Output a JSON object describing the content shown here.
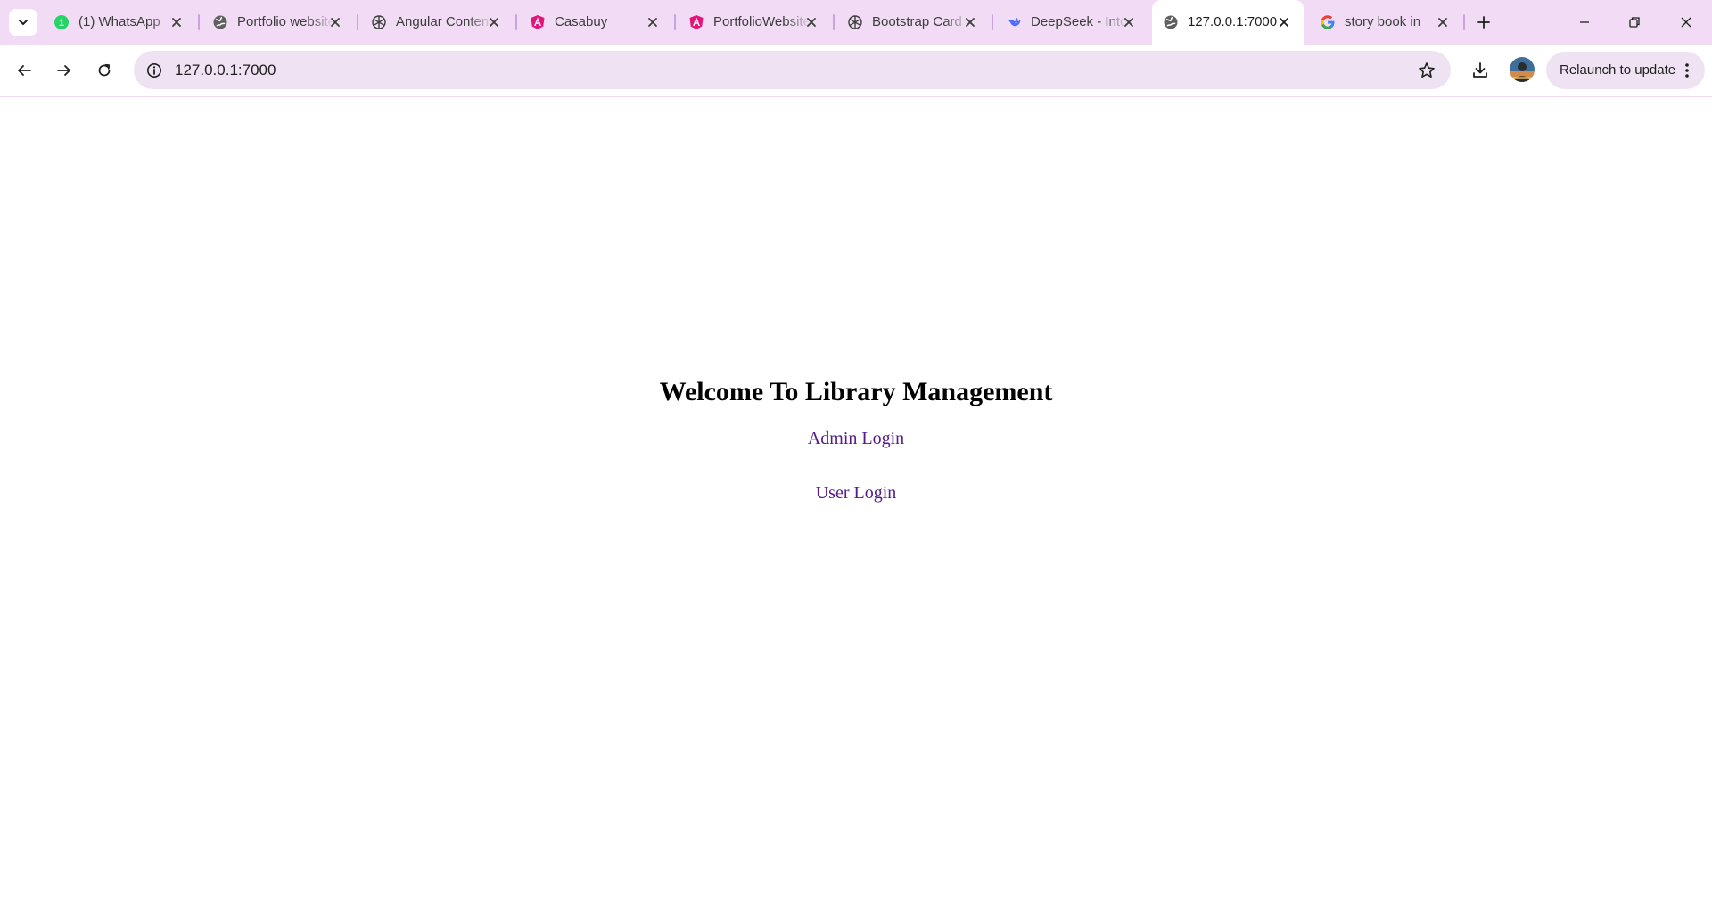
{
  "browser": {
    "tabs": [
      {
        "title": "(1) WhatsApp",
        "favicon": "whatsapp-icon",
        "active": false
      },
      {
        "title": "Portfolio website",
        "favicon": "globe-icon",
        "active": false
      },
      {
        "title": "Angular Content",
        "favicon": "chatgpt-icon",
        "active": false
      },
      {
        "title": "Casabuy",
        "favicon": "angular-icon",
        "active": false
      },
      {
        "title": "PortfolioWebsite",
        "favicon": "angular-icon",
        "active": false
      },
      {
        "title": "Bootstrap Card",
        "favicon": "chatgpt-icon",
        "active": false
      },
      {
        "title": "DeepSeek - Into",
        "favicon": "deepseek-icon",
        "active": false
      },
      {
        "title": "127.0.0.1:7000",
        "favicon": "globe-icon",
        "active": true
      },
      {
        "title": "story book in",
        "favicon": "google-icon",
        "active": false
      }
    ],
    "address_bar": {
      "url": "127.0.0.1:7000"
    },
    "relaunch_label": "Relaunch to update"
  },
  "page": {
    "title": "Welcome To Library Management",
    "links": {
      "admin_login": "Admin Login",
      "user_login": "User Login"
    }
  },
  "colors": {
    "tabstrip_bg": "#f2dcf5",
    "omnibox_bg": "#efe3f3",
    "visited_link": "#551a8b",
    "whatsapp_green": "#25d366",
    "angular_pink": "#e4157a",
    "deepseek_blue": "#4d6bfe"
  }
}
